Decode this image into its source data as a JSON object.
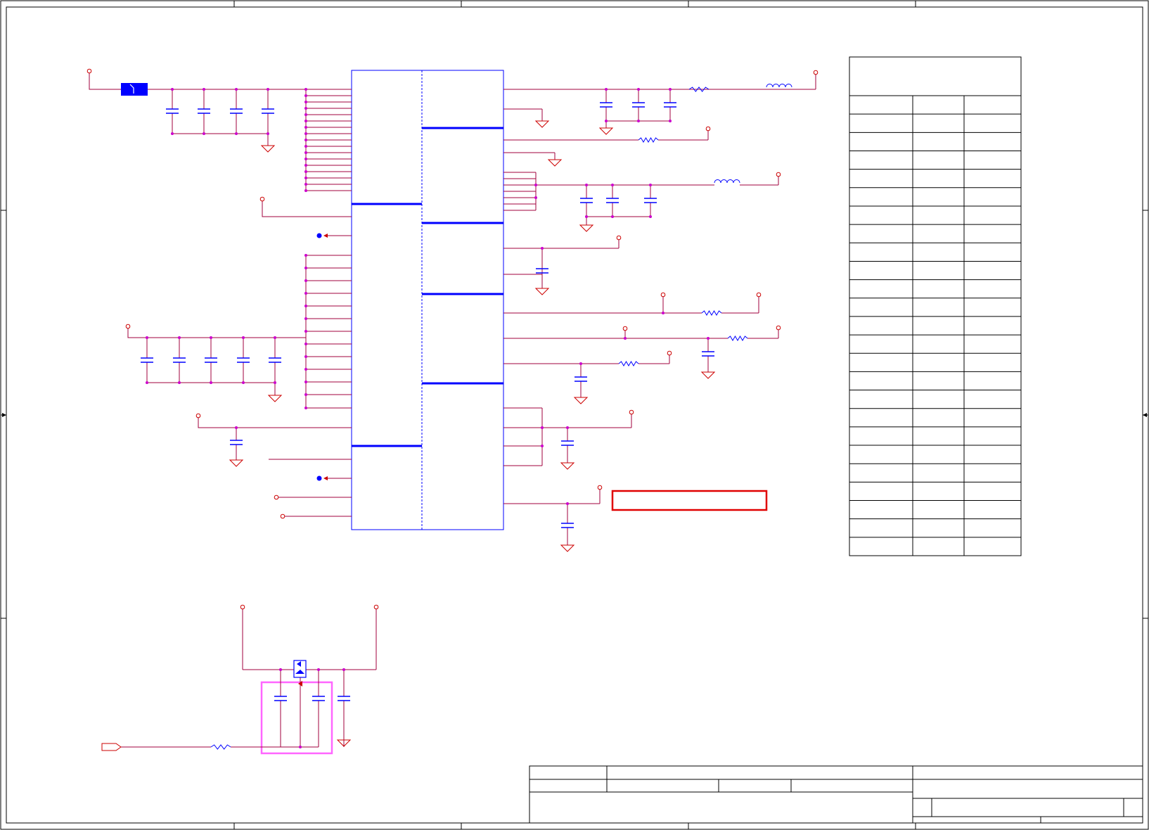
{
  "sheet": {
    "type": "electronic-schematic",
    "background": "#ffffff",
    "colors": {
      "border": "#000000",
      "wire": "#a0003c",
      "junction": "#cc00cc",
      "component": "#0000ff",
      "port": "#cc0000",
      "highlight_red": "#e00000",
      "highlight_pink": "#ff66ff",
      "table_line": "#000000"
    },
    "visible_text": []
  },
  "ic": {
    "name": "main-ic-symbol"
  },
  "pin_table": {
    "rows": 23,
    "columns": 3
  },
  "title_block": {
    "name": "drawing-title-block"
  }
}
